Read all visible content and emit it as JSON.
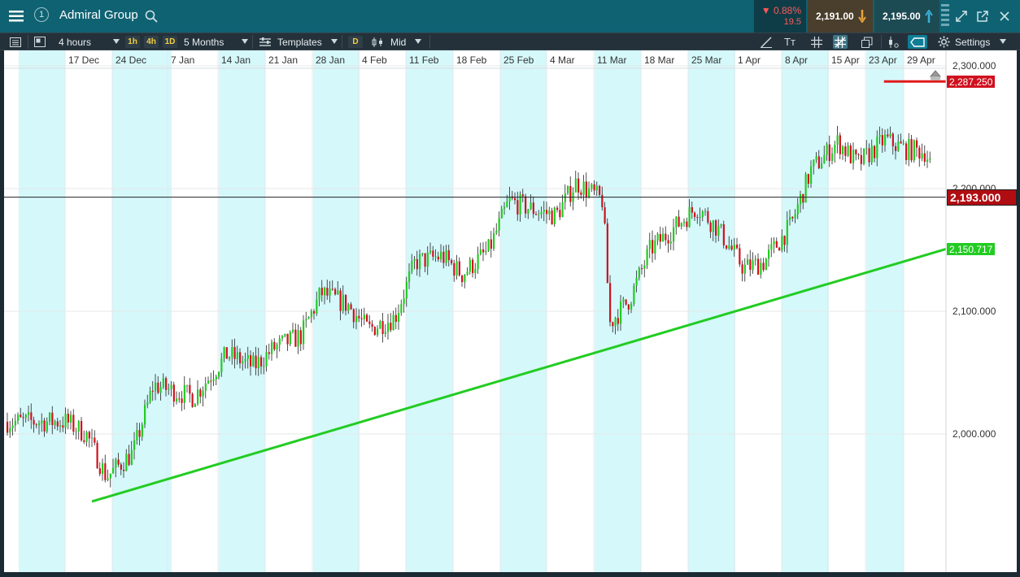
{
  "window": {
    "instrument_title": "Admiral Group",
    "workspace_number": "1",
    "change_percent": "0.88%",
    "change_abs": "19.5",
    "sell_price": "2,191.00",
    "buy_price": "2,195.00"
  },
  "toolbar": {
    "interval": "4 hours",
    "quick_intervals": [
      "1h",
      "4h",
      "1D"
    ],
    "range": "5 Months",
    "templates_label": "Templates",
    "draw_chip": "D",
    "price_type": "Mid",
    "settings_label": "Settings"
  },
  "colors": {
    "up": "#22cc22",
    "down": "#d0101e",
    "trendline": "#22cc22",
    "resistance": "#e01b1b",
    "week_band": "#d5f8fb",
    "header": "#0f6272"
  },
  "chart_data": {
    "type": "candlestick",
    "title": "Admiral Group",
    "x_ticks": [
      "17 Dec",
      "24 Dec",
      "7 Jan",
      "14 Jan",
      "21 Jan",
      "28 Jan",
      "4 Feb",
      "11 Feb",
      "18 Feb",
      "25 Feb",
      "4 Mar",
      "11 Mar",
      "18 Mar",
      "25 Mar",
      "1 Apr",
      "8 Apr",
      "15 Apr",
      "23 Apr",
      "29 Apr"
    ],
    "y_ticks": [
      "2,300.000",
      "2,200.000",
      "2,100.000",
      "2,000.000"
    ],
    "ylim": [
      1940,
      2333
    ],
    "current_price": {
      "value": 2193.0,
      "label": "2,193.000"
    },
    "resistance_line": {
      "value": 2287.25,
      "label": "2,287.250",
      "from": "15 Apr"
    },
    "trendline": {
      "from": [
        "17 Dec",
        1945
      ],
      "to_label": "2,150.717",
      "to_value": 2150.717
    },
    "close_path": [
      [
        "14 Dec",
        2010
      ],
      [
        "17 Dec",
        2000
      ],
      [
        "20 Dec",
        1965
      ],
      [
        "24 Dec",
        1985
      ],
      [
        "27 Dec",
        2040
      ],
      [
        "2 Jan",
        2030
      ],
      [
        "7 Jan",
        2065
      ],
      [
        "11 Jan",
        2055
      ],
      [
        "14 Jan",
        2070
      ],
      [
        "18 Jan",
        2080
      ],
      [
        "21 Jan",
        2115
      ],
      [
        "25 Jan",
        2105
      ],
      [
        "28 Jan",
        2085
      ],
      [
        "1 Feb",
        2095
      ],
      [
        "4 Feb",
        2140
      ],
      [
        "8 Feb",
        2145
      ],
      [
        "11 Feb",
        2130
      ],
      [
        "15 Feb",
        2150
      ],
      [
        "18 Feb",
        2190
      ],
      [
        "22 Feb",
        2182
      ],
      [
        "25 Feb",
        2178
      ],
      [
        "28 Feb",
        2205
      ],
      [
        "4 Mar",
        2190
      ],
      [
        "5 Mar",
        2090
      ],
      [
        "8 Mar",
        2110
      ],
      [
        "11 Mar",
        2150
      ],
      [
        "15 Mar",
        2170
      ],
      [
        "18 Mar",
        2185
      ],
      [
        "21 Mar",
        2168
      ],
      [
        "25 Mar",
        2135
      ],
      [
        "28 Mar",
        2140
      ],
      [
        "1 Apr",
        2170
      ],
      [
        "4 Apr",
        2215
      ],
      [
        "8 Apr",
        2238
      ],
      [
        "11 Apr",
        2220
      ],
      [
        "15 Apr",
        2240
      ],
      [
        "18 Apr",
        2232
      ],
      [
        "21 Apr",
        2230
      ],
      [
        "23 Apr",
        2205
      ],
      [
        "25 Apr",
        2200
      ],
      [
        "29 Apr",
        2193
      ]
    ]
  }
}
